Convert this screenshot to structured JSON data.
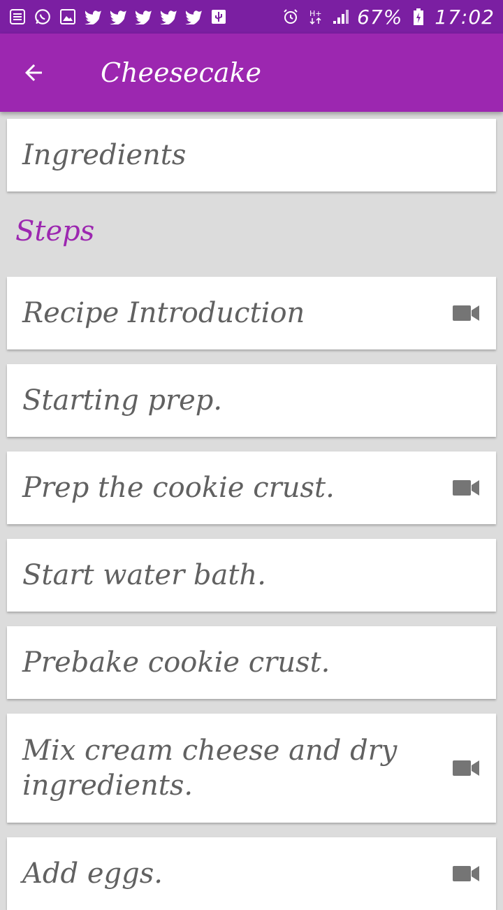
{
  "status_bar": {
    "battery": "67%",
    "time": "17:02",
    "icons_left": [
      "notes-icon",
      "whatsapp-icon",
      "gallery-icon",
      "twitter-icon",
      "twitter-icon",
      "twitter-icon",
      "twitter-icon",
      "twitter-icon",
      "usb-icon"
    ],
    "icons_right": [
      "alarm-icon",
      "hplus-icon",
      "signal-icon",
      "battery-charging-icon"
    ]
  },
  "app_bar": {
    "title": "Cheesecake",
    "back_icon": "arrow-back-icon"
  },
  "ingredients": {
    "label": "Ingredients"
  },
  "steps": {
    "title": "Steps",
    "items": [
      {
        "label": "Recipe Introduction",
        "has_video": true
      },
      {
        "label": "Starting prep.",
        "has_video": false
      },
      {
        "label": "Prep the cookie crust.",
        "has_video": true
      },
      {
        "label": "Start water bath.",
        "has_video": false
      },
      {
        "label": "Prebake cookie crust.",
        "has_video": false
      },
      {
        "label": "Mix cream cheese and dry ingredients.",
        "has_video": true
      },
      {
        "label": "Add eggs.",
        "has_video": true
      }
    ]
  },
  "colors": {
    "primary": "#9c27b0",
    "primary_dark": "#7b1fa2",
    "text": "#616161",
    "background": "#dcdcdc"
  }
}
